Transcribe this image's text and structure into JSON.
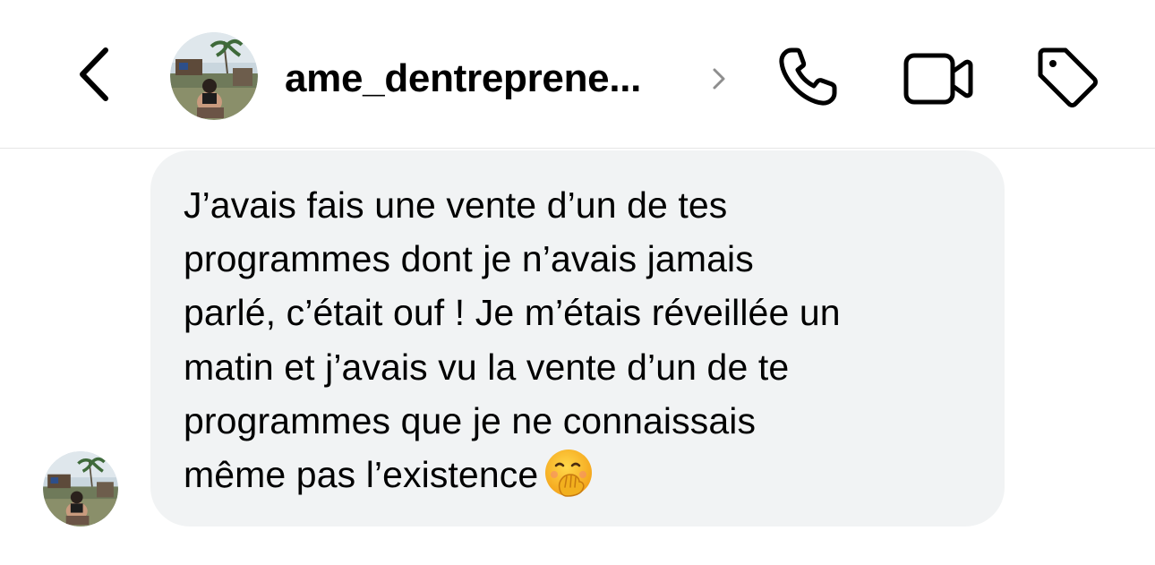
{
  "header": {
    "username": "ame_dentreprene...",
    "back_icon": "chevron-left-icon",
    "profile_chevron_icon": "chevron-right-icon",
    "actions": [
      {
        "icon": "phone-icon"
      },
      {
        "icon": "video-camera-icon"
      },
      {
        "icon": "tag-icon"
      }
    ]
  },
  "message": {
    "text": "J’avais fais une vente d’un de tes\nprogrammes dont je n’avais jamais\nparlé, c’était ouf ! Je m’étais réveillée un\nmatin et j’avais vu la vente d’un de te\nprogrammes que je ne connaissais\nmême pas l’existence",
    "emoji_icon": "face-with-hand-over-mouth-icon",
    "bubble_color": "#f1f3f4"
  },
  "colors": {
    "background": "#ffffff",
    "text": "#000000",
    "divider": "#e6e6e6",
    "secondary": "#8e8e8e"
  }
}
